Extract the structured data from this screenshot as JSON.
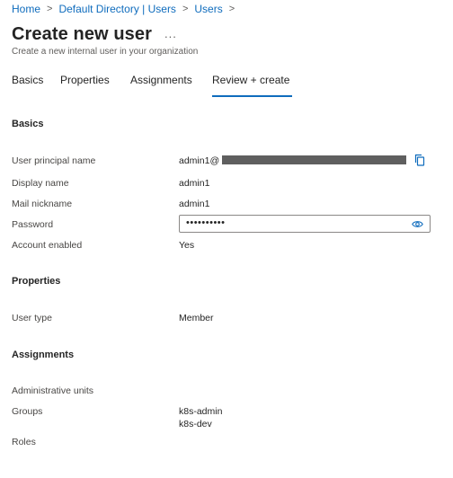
{
  "breadcrumb": {
    "items": [
      "Home",
      "Default Directory | Users",
      "Users"
    ],
    "separator": ">"
  },
  "page": {
    "title": "Create new user",
    "more_glyph": "...",
    "subtitle": "Create a new internal user in your organization"
  },
  "tabs": [
    {
      "label": "Basics",
      "active": false
    },
    {
      "label": "Properties",
      "active": false
    },
    {
      "label": "Assignments",
      "active": false
    },
    {
      "label": "Review + create",
      "active": true
    }
  ],
  "basics": {
    "heading": "Basics",
    "upn_label": "User principal name",
    "upn_value": "admin1@",
    "display_name_label": "Display name",
    "display_name_value": "admin1",
    "mail_nickname_label": "Mail nickname",
    "mail_nickname_value": "admin1",
    "password_label": "Password",
    "password_value": "••••••••••",
    "account_enabled_label": "Account enabled",
    "account_enabled_value": "Yes"
  },
  "properties": {
    "heading": "Properties",
    "user_type_label": "User type",
    "user_type_value": "Member"
  },
  "assignments": {
    "heading": "Assignments",
    "admin_units_label": "Administrative units",
    "groups_label": "Groups",
    "groups": [
      "k8s-admin",
      "k8s-dev"
    ],
    "roles_label": "Roles"
  },
  "colors": {
    "accent": "#0f6cbd",
    "redaction": "#5f5f5f"
  },
  "icons": [
    "chevron-right-icon",
    "more-icon",
    "copy-icon",
    "eye-icon"
  ]
}
